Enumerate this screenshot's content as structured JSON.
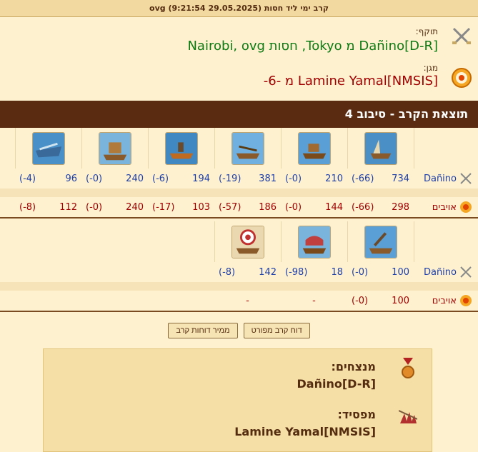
{
  "header": {
    "title": "קרב ימי ליד חסות (29.05.2025 9:21:54) ovg"
  },
  "attacker": {
    "label": "תוקף:",
    "line": "Dañino[D-R] מ Tokyo, חסות Nairobi, ovg",
    "icon": "crossed-swords-icon"
  },
  "defender": {
    "label": "מגן:",
    "line": "Lamine Yamal[NMSIS] מ -6-",
    "icon": "target-shield-icon"
  },
  "result_title": "תוצאת הקרב - סיבוב 4",
  "round1": {
    "units": [
      "ram-ship-icon",
      "catapult-ship-icon",
      "ballista-ship-icon",
      "fire-ship-icon",
      "steam-ram-icon",
      "paddle-steamer-icon"
    ],
    "attacker_label": "Dañino",
    "attacker": [
      {
        "count": "734",
        "loss": "(66-)"
      },
      {
        "count": "210",
        "loss": "(0-)"
      },
      {
        "count": "381",
        "loss": "(19-)"
      },
      {
        "count": "194",
        "loss": "(6-)"
      },
      {
        "count": "240",
        "loss": "(0-)"
      },
      {
        "count": "96",
        "loss": "(4-)"
      }
    ],
    "enemy_label": "אויבים",
    "enemy": [
      {
        "count": "298",
        "loss": "(66-)"
      },
      {
        "count": "144",
        "loss": "(0-)"
      },
      {
        "count": "186",
        "loss": "(57-)"
      },
      {
        "count": "103",
        "loss": "(17-)"
      },
      {
        "count": "240",
        "loss": "(0-)"
      },
      {
        "count": "112",
        "loss": "(8-)"
      }
    ]
  },
  "round2": {
    "units": [
      "mortar-ship-icon",
      "rocket-ship-icon",
      "target-ship-icon"
    ],
    "attacker_label": "Dañino",
    "attacker": [
      {
        "count": "100",
        "loss": "(0-)"
      },
      {
        "count": "18",
        "loss": "(98-)"
      },
      {
        "count": "142",
        "loss": "(8-)"
      }
    ],
    "enemy_label": "אויבים",
    "enemy": [
      {
        "count": "100",
        "loss": "(0-)"
      },
      {
        "count": "-",
        "loss": ""
      },
      {
        "count": "-",
        "loss": ""
      }
    ]
  },
  "buttons": {
    "detailed": "דוח קרב מפורט",
    "converter": "ממיר דוחות קרב"
  },
  "summary": {
    "winners_title": "מנצחים:",
    "winners": "Dañino[D-R]",
    "losers_title": "מפסיד:",
    "losers": "Lamine Yamal[NMSIS]"
  },
  "colors": {
    "attacker_green": "#0d7a12",
    "defender_red": "#a10000",
    "header_bar": "#5a2b10"
  }
}
